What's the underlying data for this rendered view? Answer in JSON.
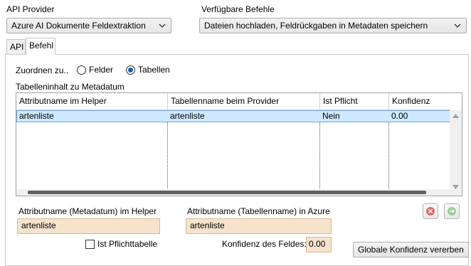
{
  "provider": {
    "label": "API Provider",
    "selected": "Azure AI Dokumente Feldextraktion"
  },
  "commands": {
    "label": "Verfügbare Befehle",
    "selected": "Dateien hochladen, Feldrückgaben in Metadaten speichern"
  },
  "tabs": [
    {
      "label": "API",
      "active": false
    },
    {
      "label": "Befehl",
      "active": true
    }
  ],
  "assign": {
    "label": "Zuordnen zu..",
    "options": [
      {
        "label": "Felder",
        "selected": false
      },
      {
        "label": "Tabellen",
        "selected": true
      }
    ]
  },
  "table_section": {
    "title": "Tabelleninhalt zu Metadatum",
    "columns": [
      "Attributname im Helper",
      "Tabellenname beim Provider",
      "Ist Pflicht",
      "Konfidenz"
    ],
    "rows": [
      [
        "artenliste",
        "artenliste",
        "Nein",
        "0.00"
      ]
    ]
  },
  "form": {
    "helper_label": "Attributname (Metadatum) im Helper",
    "helper_value": "artenliste",
    "azure_label": "Attributname (Tabellenname) in Azure",
    "azure_value": "artenliste",
    "required_label": "Ist Pflichttabelle",
    "required_checked": false,
    "confidence_label": "Konfidenz des Feldes:",
    "confidence_value": "0.00",
    "global_button": "Globale Konfidenz vererben"
  },
  "colors": {
    "selection": "#cde8ff",
    "field_bg": "#f6e3cc",
    "remove_icon": "#d9534f",
    "add_icon": "#5cb85c"
  }
}
